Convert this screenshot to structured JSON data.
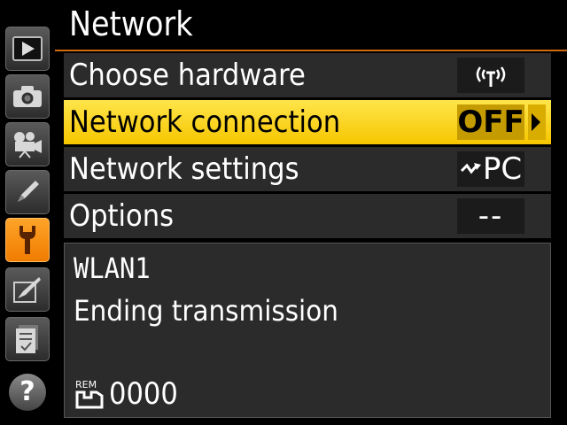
{
  "header": {
    "title": "Network"
  },
  "sidebar": {
    "tabs": [
      {
        "icon": "playback-icon",
        "active": false
      },
      {
        "icon": "camera-icon",
        "active": false
      },
      {
        "icon": "movie-icon",
        "active": false
      },
      {
        "icon": "pencil-icon",
        "active": false
      },
      {
        "icon": "wrench-icon",
        "active": true
      },
      {
        "icon": "retouch-icon",
        "active": false
      },
      {
        "icon": "recent-settings-icon",
        "active": false
      },
      {
        "icon": "help-icon",
        "active": false
      }
    ]
  },
  "menu": {
    "items": [
      {
        "label": "Choose hardware",
        "value": "((T))",
        "value_icon": "wireless-antenna-icon",
        "selected": false
      },
      {
        "label": "Network connection",
        "value": "OFF",
        "selected": true
      },
      {
        "label": "Network settings",
        "value": "PC",
        "value_icon": "pc-connection-icon",
        "selected": false
      },
      {
        "label": "Options",
        "value": "--",
        "selected": false
      }
    ]
  },
  "info": {
    "profile": "WLAN1",
    "status": "Ending transmission",
    "remaining_icon_text": "REM",
    "remaining_count": "0000"
  },
  "colors": {
    "highlight": "#f6c600",
    "active_tab": "#ef7c00",
    "title_rule": "#d06a10",
    "row_background": "#2b2b2b"
  }
}
